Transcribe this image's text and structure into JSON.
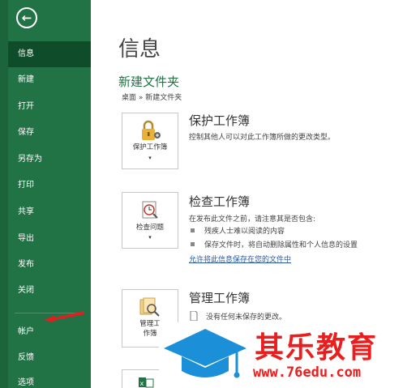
{
  "sidebar": {
    "back_icon": "back-arrow-icon",
    "items": [
      {
        "label": "信息",
        "active": true
      },
      {
        "label": "新建"
      },
      {
        "label": "打开"
      },
      {
        "label": "保存"
      },
      {
        "label": "另存为"
      },
      {
        "label": "打印"
      },
      {
        "label": "共享"
      },
      {
        "label": "导出"
      },
      {
        "label": "发布"
      },
      {
        "label": "关闭"
      },
      {
        "label": "帐户"
      },
      {
        "label": "反馈"
      },
      {
        "label": "选项"
      }
    ]
  },
  "main": {
    "title": "信息",
    "folder_name": "新建文件夹",
    "breadcrumb": "桌面 » 新建文件夹",
    "sections": [
      {
        "tile_label": "保护工作簿",
        "heading": "保护工作簿",
        "description": "控制其他人可以对此工作簿所做的更改类型。"
      },
      {
        "tile_label": "检查问题",
        "heading": "检查工作簿",
        "description": "在发布此文件之前，请注意其是否包含:",
        "bullets": [
          "残疾人士难以阅读的内容",
          "保存文件时，将自动删除属性和个人信息的设置"
        ],
        "link": "允许将此信息保存在您的文件中"
      },
      {
        "tile_label_1": "管理工",
        "tile_label_2": "作簿",
        "heading": "管理工作簿",
        "description": "没有任何未保存的更改。"
      }
    ]
  },
  "watermark": {
    "title": "其乐教育",
    "url": "www.76edu.com"
  },
  "colors": {
    "sidebar": "#217346",
    "sidebar_active": "#0f4d2a",
    "accent_green": "#217346",
    "annotation_red": "#e02020",
    "watermark_red": "#e91e1e",
    "watermark_blue": "#1b8fd8"
  }
}
